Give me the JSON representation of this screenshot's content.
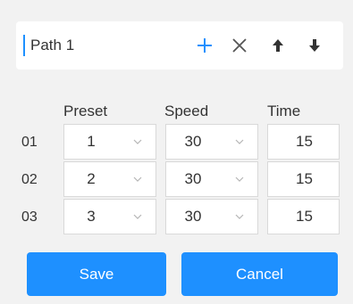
{
  "path": {
    "name": "Path 1",
    "accent_color": "#1e90ff",
    "toolbar": [
      {
        "name": "add-icon"
      },
      {
        "name": "close-icon"
      },
      {
        "name": "arrow-up-icon"
      },
      {
        "name": "arrow-down-icon"
      }
    ]
  },
  "columns": {
    "preset": "Preset",
    "speed": "Speed",
    "time": "Time"
  },
  "rows": [
    {
      "index": "01",
      "preset": "1",
      "speed": "30",
      "time": "15"
    },
    {
      "index": "02",
      "preset": "2",
      "speed": "30",
      "time": "15"
    },
    {
      "index": "03",
      "preset": "3",
      "speed": "30",
      "time": "15"
    }
  ],
  "buttons": {
    "save": "Save",
    "cancel": "Cancel",
    "color": "#1e90ff"
  }
}
